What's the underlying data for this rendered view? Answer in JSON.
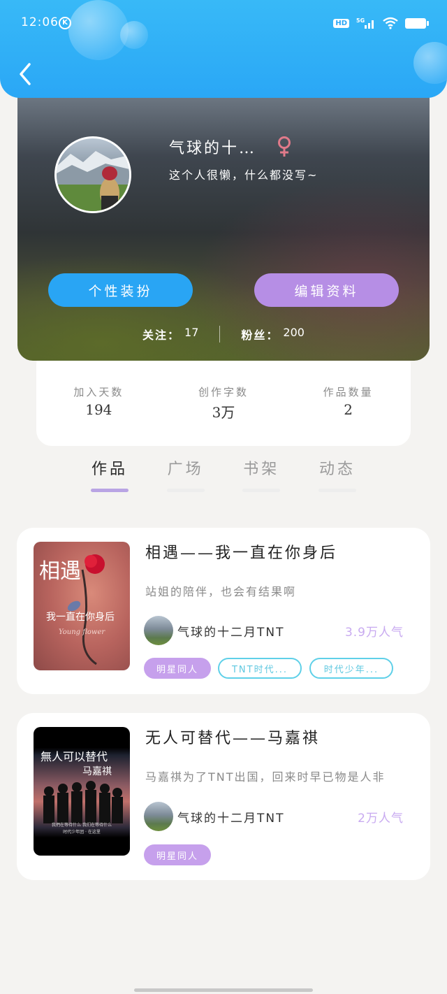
{
  "status_bar": {
    "time": "12:06",
    "k_label": "K",
    "hd_label": "HD",
    "network": "5G"
  },
  "profile": {
    "nickname": "气球的十…",
    "bio": "这个人很懒，什么都没写~",
    "decorate_button": "个性装扮",
    "edit_button": "编辑资料",
    "following_label": "关注：",
    "following_count": "17",
    "fans_label": "粉丝：",
    "fans_count": "200"
  },
  "stats": [
    {
      "label": "加入天数",
      "value": "194"
    },
    {
      "label": "创作字数",
      "value": "3万"
    },
    {
      "label": "作品数量",
      "value": "2"
    }
  ],
  "tabs": [
    {
      "label": "作品",
      "active": true
    },
    {
      "label": "广场",
      "active": false
    },
    {
      "label": "书架",
      "active": false
    },
    {
      "label": "动态",
      "active": false
    }
  ],
  "works": [
    {
      "title": "相遇——我一直在你身后",
      "desc": "站姐的陪伴，也会有结果啊",
      "author": "气球的十二月TNT",
      "popularity": "3.9万人气",
      "cover_text": "相遇",
      "cover_sub": "我一直在你身后",
      "cover_en": "Young flower",
      "tags": [
        "明星同人",
        "TNT时代...",
        "时代少年..."
      ]
    },
    {
      "title": "无人可替代——马嘉祺",
      "desc": "马嘉祺为了TNT出国，回来时早已物是人非",
      "author": "气球的十二月TNT",
      "popularity": "2万人气",
      "cover_text": "無人可以替代",
      "cover_sub": "马嘉祺",
      "cover_small": "我們在等待什么 我们在等待什么",
      "cover_small2": "时代少年团 · 在这里",
      "tags": [
        "明星同人"
      ]
    }
  ],
  "colors": {
    "header_blue": "#2aa7f6",
    "decor_button": "#29a5f4",
    "edit_button": "#b68ee5",
    "tag_fill": "#c6a0ec",
    "tag_outline": "#5fd0e8",
    "popularity": "#c8aaf0",
    "female_icon": "#e07a8a"
  },
  "icons": [
    "back-arrow-icon",
    "female-icon",
    "wifi-icon",
    "signal-icon",
    "battery-icon"
  ]
}
